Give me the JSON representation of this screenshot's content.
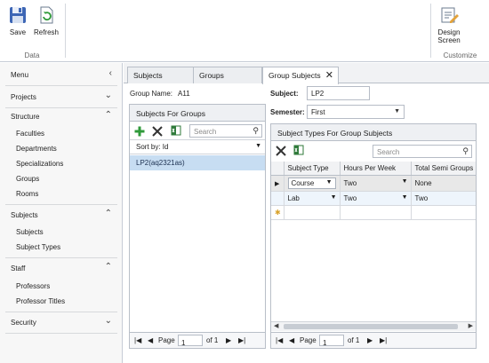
{
  "ribbon": {
    "save_label": "Save",
    "refresh_label": "Refresh",
    "data_group_label": "Data",
    "design_label_1": "Design",
    "design_label_2": "Screen",
    "customize_group_label": "Customize"
  },
  "sidebar": {
    "menu_label": "Menu",
    "sections": [
      {
        "label": "Projects",
        "items": []
      },
      {
        "label": "Structure",
        "items": [
          "Faculties",
          "Departments",
          "Specializations",
          "Groups",
          "Rooms"
        ]
      },
      {
        "label": "Subjects",
        "items": [
          "Subjects",
          "Subject Types"
        ]
      },
      {
        "label": "Staff",
        "items": [
          "Professors",
          "Professor Titles"
        ]
      },
      {
        "label": "Security",
        "items": []
      }
    ]
  },
  "tabs": [
    {
      "label": "Subjects"
    },
    {
      "label": "Groups"
    },
    {
      "label": "Group Subjects"
    }
  ],
  "form": {
    "group_name_label": "Group Name:",
    "group_name_value": "A11",
    "subject_label": "Subject:",
    "subject_value": "LP2",
    "semester_label": "Semester:",
    "semester_value": "First"
  },
  "left_panel": {
    "title": "Subjects For Groups",
    "search_placeholder": "Search",
    "sort_label": "Sort by: Id",
    "items": [
      "LP2(aq2321as)"
    ],
    "pager": {
      "page_label": "Page",
      "page_value": "1",
      "of_label": "of 1"
    }
  },
  "right_panel": {
    "title": "Subject Types For Group Subjects",
    "search_placeholder": "Search",
    "columns": [
      "Subject Type",
      "Hours Per Week",
      "Total Semi Groups"
    ],
    "rows": [
      {
        "type": "Course",
        "hours": "Two",
        "total": "None"
      },
      {
        "type": "Lab",
        "hours": "Two",
        "total": "Two"
      }
    ],
    "pager": {
      "page_label": "Page",
      "page_value": "1",
      "of_label": "of 1"
    }
  }
}
